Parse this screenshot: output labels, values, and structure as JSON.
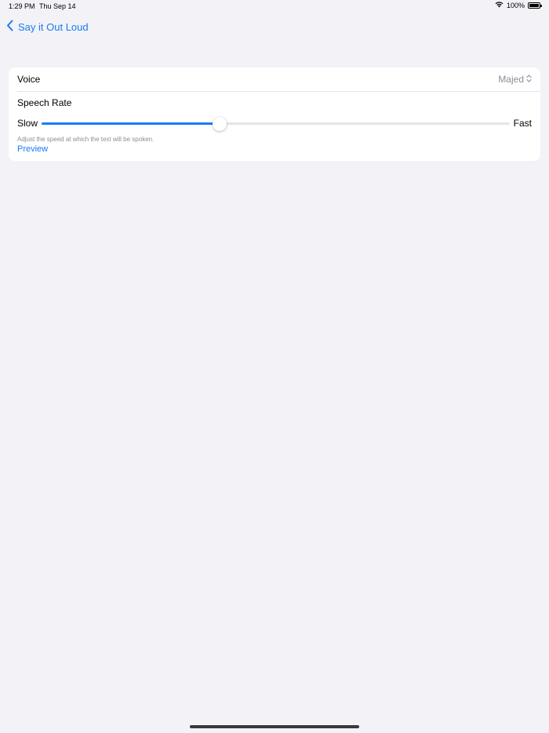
{
  "status_bar": {
    "time": "1:29 PM",
    "date": "Thu Sep 14",
    "battery": "100%",
    "wifi_icon": "wifi-icon",
    "battery_icon": "battery-icon"
  },
  "nav": {
    "back_label": "Say it Out Loud",
    "back_icon": "chevron-left-icon"
  },
  "settings": {
    "voice_label": "Voice",
    "voice_value": "Majed",
    "voice_icon": "chevron-up-down-icon",
    "rate_label": "Speech Rate",
    "slow_label": "Slow",
    "fast_label": "Fast",
    "rate_value": 0.38,
    "hint": "Adjust the speed at which the text will be spoken.",
    "preview_label": "Preview"
  },
  "colors": {
    "accent": "#1a7bf4",
    "background": "#f2f2f7",
    "secondary_text": "#8e8e93"
  }
}
